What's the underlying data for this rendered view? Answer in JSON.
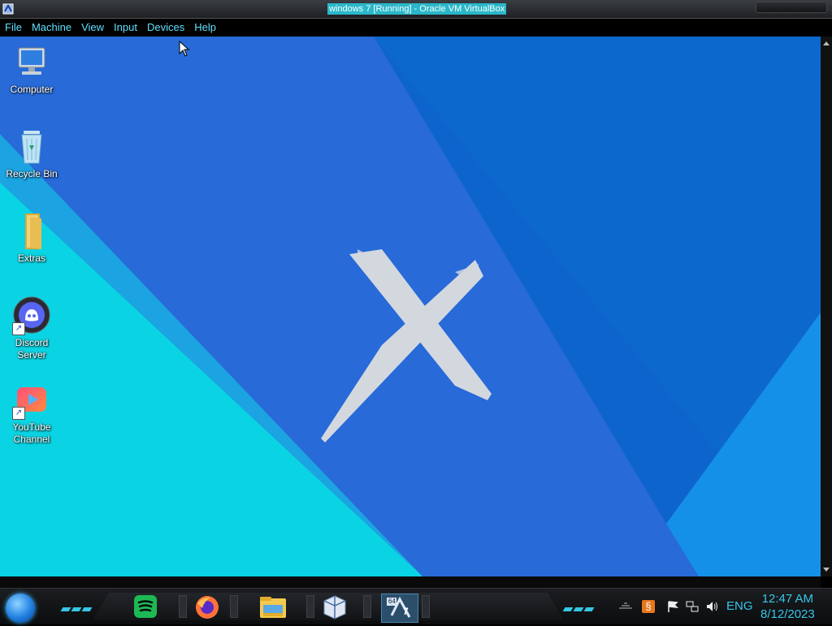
{
  "window": {
    "title": "windows 7 [Running] - Oracle VM VirtualBox",
    "app_icon": "virtualbox-icon"
  },
  "menu": [
    "File",
    "Machine",
    "View",
    "Input",
    "Devices",
    "Help"
  ],
  "desktop": {
    "icons": [
      {
        "label": "Computer",
        "icon": "computer-icon"
      },
      {
        "label": "Recycle Bin",
        "icon": "recycle-bin-icon"
      },
      {
        "label": "Extras",
        "icon": "folder-icon"
      },
      {
        "label": "Discord\nServer",
        "icon": "discord-icon",
        "shortcut": true
      },
      {
        "label": "YouTube\nChannel",
        "icon": "youtube-icon",
        "shortcut": true
      }
    ],
    "wallpaper_colors": {
      "cyan": "#0ad4e3",
      "blue": "#1f73d8",
      "deep_blue": "#2848c8",
      "x_mark": "#d3d8df"
    }
  },
  "taskbar": {
    "pinned": [
      {
        "name": "spotify",
        "icon": "spotify-icon"
      },
      {
        "name": "firefox",
        "icon": "firefox-icon"
      },
      {
        "name": "file-explorer",
        "icon": "file-explorer-icon"
      },
      {
        "name": "virtualbox",
        "icon": "virtualbox-icon"
      },
      {
        "name": "windows-7-vm",
        "icon": "windows7-vm-icon",
        "badge": "64",
        "number": "7"
      }
    ],
    "tray": {
      "language": "ENG",
      "time": "12:47 AM",
      "date": "8/12/2023",
      "icons": [
        "show-hidden-icon",
        "java-update-icon",
        "action-center-flag-icon",
        "network-icon",
        "volume-icon"
      ]
    },
    "accent_color": "#36c7e8"
  }
}
